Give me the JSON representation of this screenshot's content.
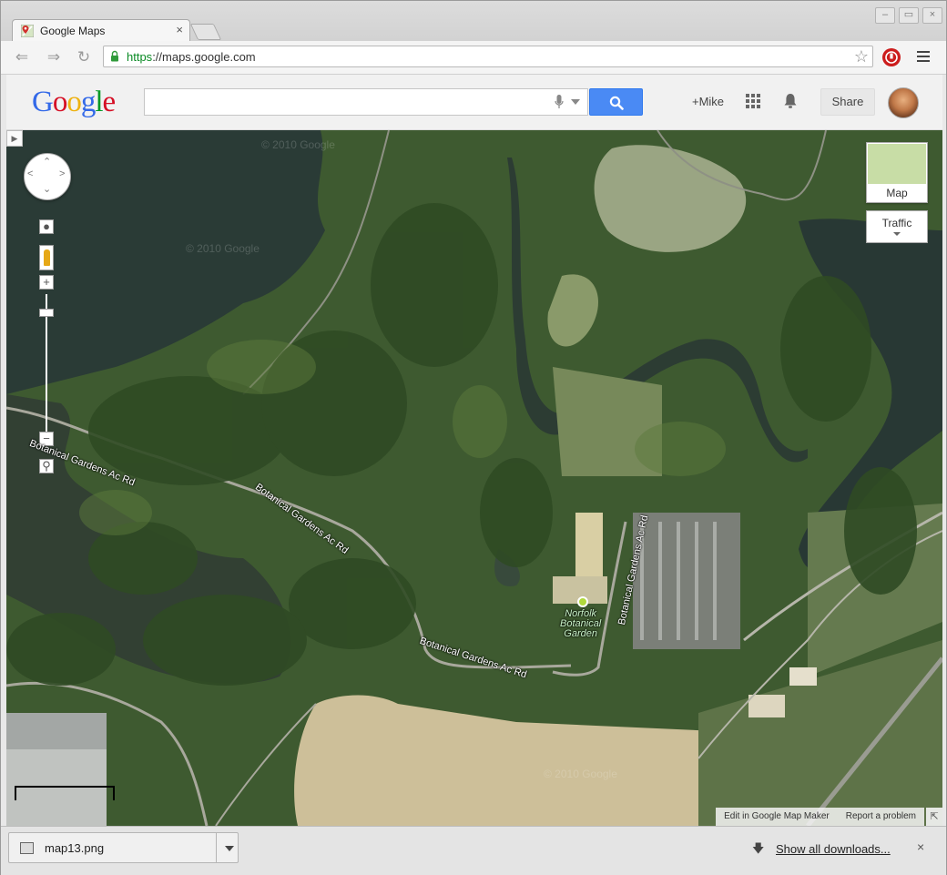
{
  "browser": {
    "tab_title": "Google Maps",
    "tab_close": "×",
    "url_scheme": "https",
    "url_rest": "://maps.google.com",
    "window_buttons": [
      "–",
      "▭",
      "×"
    ]
  },
  "google_bar": {
    "logo_letters": [
      "G",
      "o",
      "o",
      "g",
      "l",
      "e"
    ],
    "logo_colors": [
      "#3369e8",
      "#d50f25",
      "#eeb211",
      "#3369e8",
      "#009925",
      "#d50f25"
    ],
    "search_placeholder": "",
    "user_link": "+Mike",
    "share_label": "Share"
  },
  "map": {
    "view": "satellite",
    "map_type_label": "Map",
    "traffic_label": "Traffic",
    "place_name": "Norfolk Botanical Garden",
    "place_lines": [
      "Norfolk",
      "Botanical",
      "Garden"
    ],
    "road_label": "Botanical Gardens Ac Rd",
    "watermark": "© 2010 Google",
    "footer_links": [
      "Edit in Google Map Maker",
      "Report a problem"
    ],
    "zoom_in": "+",
    "zoom_out": "−"
  },
  "downloads": {
    "file_name": "map13.png",
    "show_all": "Show all downloads...",
    "close": "×"
  }
}
